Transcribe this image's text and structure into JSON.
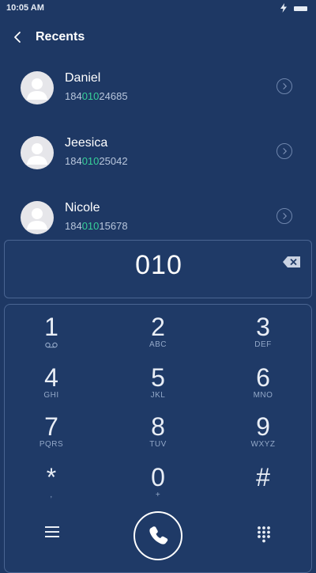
{
  "status": {
    "time": "10:05 AM"
  },
  "header": {
    "title": "Recents"
  },
  "contacts": [
    {
      "name": "Daniel",
      "number_prefix": "184",
      "number_match": "010",
      "number_suffix": "24685"
    },
    {
      "name": "Jeesica",
      "number_prefix": "184",
      "number_match": "010",
      "number_suffix": "25042"
    },
    {
      "name": "Nicole",
      "number_prefix": "184",
      "number_match": "010",
      "number_suffix": "15678"
    }
  ],
  "dialer": {
    "input": "010"
  },
  "keys": [
    {
      "digit": "1",
      "letters": ""
    },
    {
      "digit": "2",
      "letters": "ABC"
    },
    {
      "digit": "3",
      "letters": "DEF"
    },
    {
      "digit": "4",
      "letters": "GHI"
    },
    {
      "digit": "5",
      "letters": "JKL"
    },
    {
      "digit": "6",
      "letters": "MNO"
    },
    {
      "digit": "7",
      "letters": "PQRS"
    },
    {
      "digit": "8",
      "letters": "TUV"
    },
    {
      "digit": "9",
      "letters": "WXYZ"
    },
    {
      "digit": "*",
      "letters": ","
    },
    {
      "digit": "0",
      "letters": "+"
    },
    {
      "digit": "#",
      "letters": ""
    }
  ],
  "colors": {
    "background": "#1e3864",
    "match_highlight": "#37d09a",
    "panel_border": "#4a6592"
  },
  "icons": [
    "back-icon",
    "info-icon",
    "backspace-icon",
    "voicemail-icon",
    "menu-icon",
    "phone-icon",
    "keypad-grid-icon"
  ]
}
